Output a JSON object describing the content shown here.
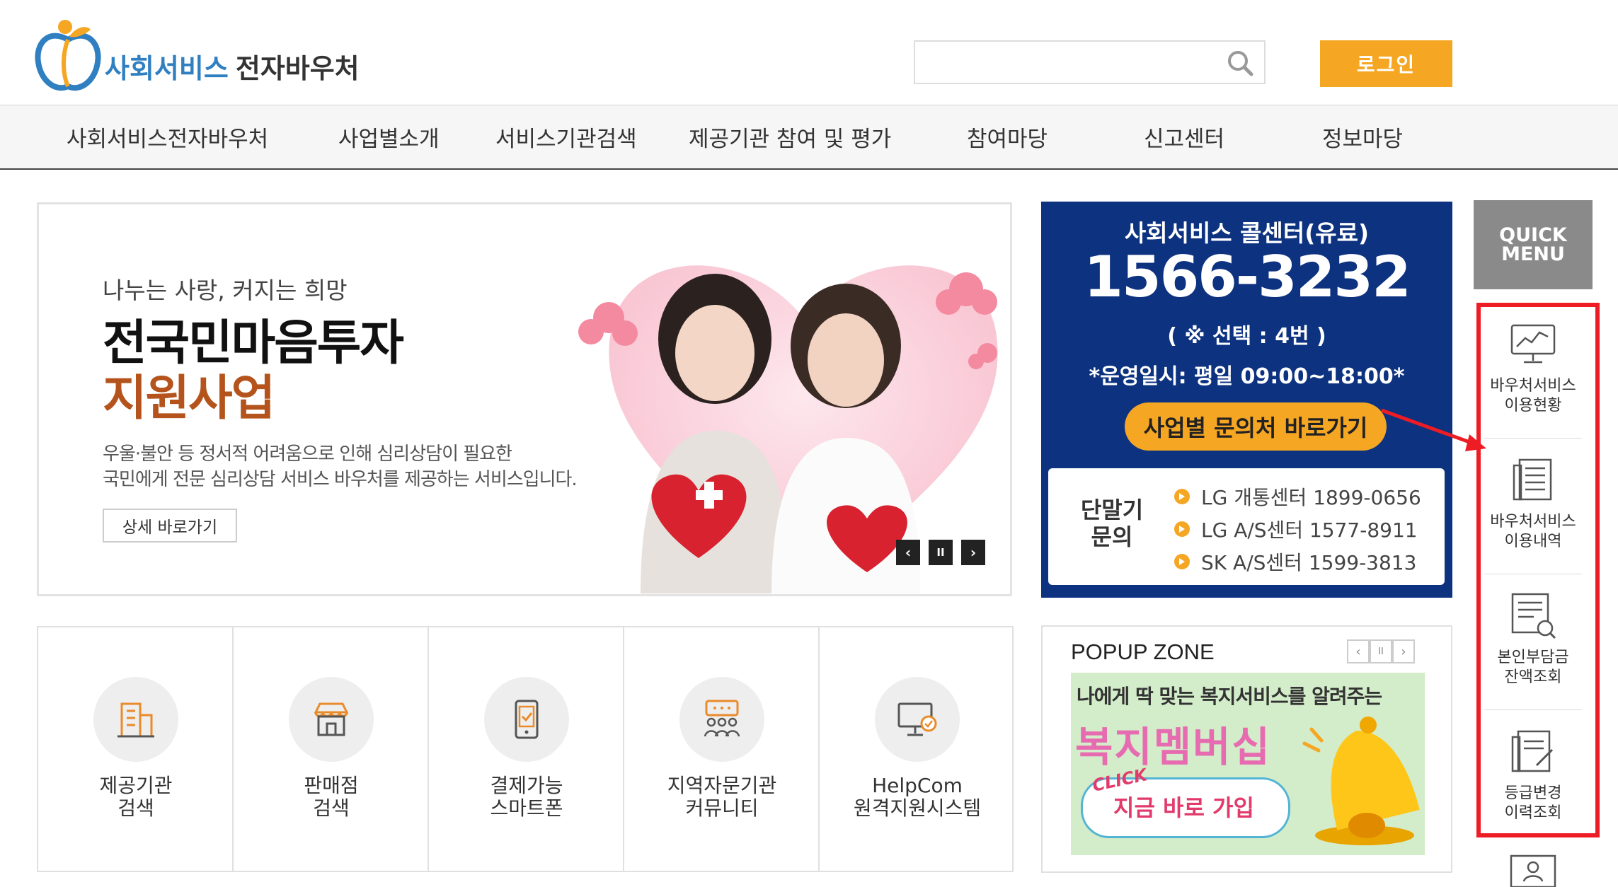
{
  "header": {
    "logo_text_primary": "사회서비스",
    "logo_text_secondary": "전자바우처",
    "search_placeholder": "",
    "login_label": "로그인"
  },
  "nav": {
    "items": [
      "사회서비스전자바우처",
      "사업별소개",
      "서비스기관검색",
      "제공기관 참여 및 평가",
      "참여마당",
      "신고센터",
      "정보마당"
    ]
  },
  "hero": {
    "subtitle": "나누는 사랑, 커지는 희망",
    "title_line1": "전국민마음투자",
    "title_line2": "지원사업",
    "desc_line1": "우울·불안 등 정서적 어려움으로 인해 심리상담이 필요한",
    "desc_line2": "국민에게 전문 심리상담 서비스 바우처를 제공하는 서비스입니다.",
    "detail_label": "상세 바로가기",
    "controls": {
      "prev": "‹",
      "pause": "II",
      "next": "›"
    }
  },
  "callcenter": {
    "title": "사회서비스 콜센터(유료)",
    "phone": "1566-3232",
    "select_note": "( ※ 선택 : 4번 )",
    "hours": "*운영일시: 평일 09:00~18:00*",
    "inquiry_button": "사업별 문의처 바로가기",
    "terminal_label_line1": "단말기",
    "terminal_label_line2": "문의",
    "terminal_rows": [
      "LG 개통센터 1899-0656",
      "LG A/S센터 1577-8911",
      "SK A/S센터 1599-3813"
    ]
  },
  "quick_menu": {
    "title_line1": "QUICK",
    "title_line2": "MENU",
    "items": [
      {
        "line1": "바우처서비스",
        "line2": "이용현황",
        "icon": "monitor-chart-icon"
      },
      {
        "line1": "바우처서비스",
        "line2": "이용내역",
        "icon": "document-list-icon"
      },
      {
        "line1": "본인부담금",
        "line2": "잔액조회",
        "icon": "document-search-icon"
      },
      {
        "line1": "등급변경",
        "line2": "이력조회",
        "icon": "document-edit-icon"
      }
    ],
    "highlight_color": "#ee1c24"
  },
  "shortcuts": [
    {
      "line1": "제공기관",
      "line2": "검색",
      "icon": "building-icon"
    },
    {
      "line1": "판매점",
      "line2": "검색",
      "icon": "store-icon"
    },
    {
      "line1": "결제가능",
      "line2": "스마트폰",
      "icon": "smartphone-icon"
    },
    {
      "line1": "지역자문기관",
      "line2": "커뮤니티",
      "icon": "community-icon"
    },
    {
      "line1": "HelpCom",
      "line2": "원격지원시스템",
      "icon": "remote-support-icon"
    }
  ],
  "popup_zone": {
    "title": "POPUP ZONE",
    "controls": {
      "prev": "‹",
      "pause": "II",
      "next": "›"
    },
    "banner_line1": "나에게 딱 맞는 복지서비스를 알려주는",
    "banner_line2": "복지멤버십",
    "banner_click": "CLICK",
    "banner_join": "지금 바로 가입"
  },
  "colors": {
    "brand_blue": "#2f7fc1",
    "accent_orange": "#f5a623",
    "callcenter_navy": "#0c3280",
    "hero_title_brown": "#b5531c"
  }
}
